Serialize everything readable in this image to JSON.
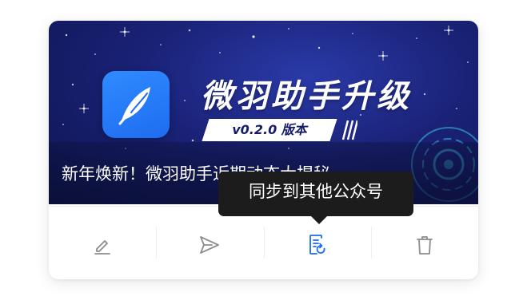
{
  "cover": {
    "banner_title": "微羽助手升级",
    "version_label": "v0.2.0 版本",
    "article_title": "新年焕新！微羽助手近期动态大揭秘~~",
    "app_icon": "feather-icon",
    "colors": {
      "background": "#1a2277",
      "app_icon": "#1f6cf0"
    }
  },
  "tooltip": {
    "text": "同步到其他公众号"
  },
  "actions": [
    {
      "icon": "pencil-edit-icon",
      "color": "#8c8c8c"
    },
    {
      "icon": "send-icon",
      "color": "#8c8c8c"
    },
    {
      "icon": "document-sync-icon",
      "color": "#1b6bf0"
    },
    {
      "icon": "trash-icon",
      "color": "#8c8c8c"
    }
  ]
}
